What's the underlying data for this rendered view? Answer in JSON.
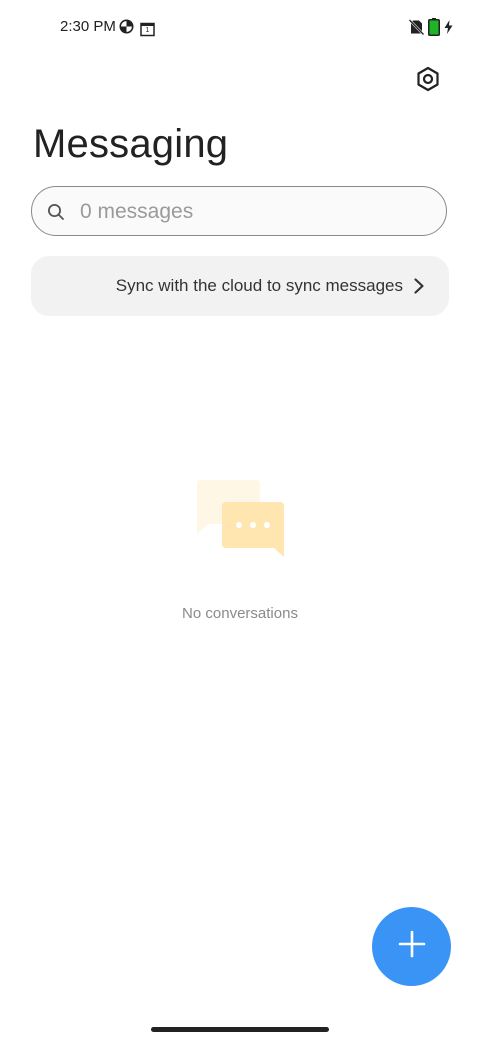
{
  "status_bar": {
    "time": "2:30 PM",
    "left_icons": [
      "data-saver-icon",
      "calendar-icon"
    ],
    "calendar_day": "1",
    "right_icons": [
      "no-sim-icon",
      "battery-icon",
      "charging-icon"
    ]
  },
  "header": {
    "settings_icon": "settings-icon",
    "title": "Messaging"
  },
  "search": {
    "placeholder": "0 messages",
    "value": ""
  },
  "banner": {
    "text": "Sync with the cloud to sync messages"
  },
  "empty_state": {
    "text": "No conversations"
  },
  "fab": {
    "icon": "plus-icon",
    "color": "#3a94f5"
  },
  "colors": {
    "accent": "#3a94f5",
    "battery": "#1fb32a",
    "illustration": "#ffe6b0"
  }
}
